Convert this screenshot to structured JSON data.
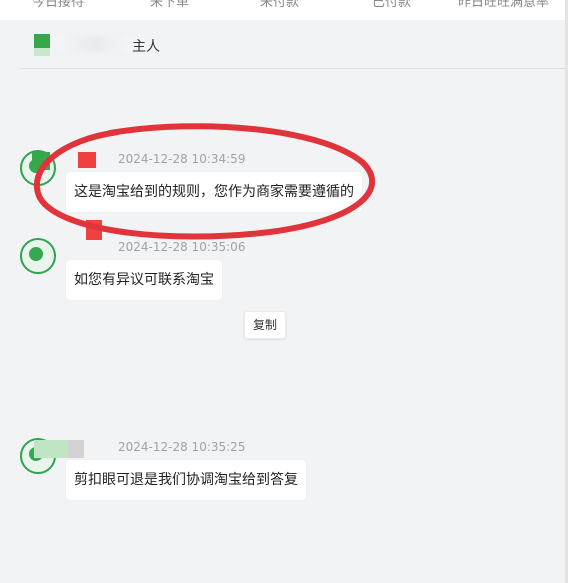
{
  "top_stats": [
    {
      "label": "今日接待"
    },
    {
      "label": "未下单"
    },
    {
      "label": "未付款"
    },
    {
      "label": "已付款"
    },
    {
      "label": "昨日旺旺满意率"
    }
  ],
  "header": {
    "name_suffix": "主人"
  },
  "messages": [
    {
      "time": "2024-12-28 10:34:59",
      "text": "这是淘宝给到的规则，您作为商家需要遵循的"
    },
    {
      "time": "2024-12-28 10:35:06",
      "text": "如您有异议可联系淘宝"
    },
    {
      "time": "2024-12-28 10:35:25",
      "text": "剪扣眼可退是我们协调淘宝给到答复"
    }
  ],
  "copy_button_label": "复制",
  "colors": {
    "background": "#f2f3f5",
    "bubble": "#ffffff",
    "avatar_green": "#2da44e",
    "annotation_red": "#e0343a",
    "timestamp": "#a2a2a2"
  }
}
